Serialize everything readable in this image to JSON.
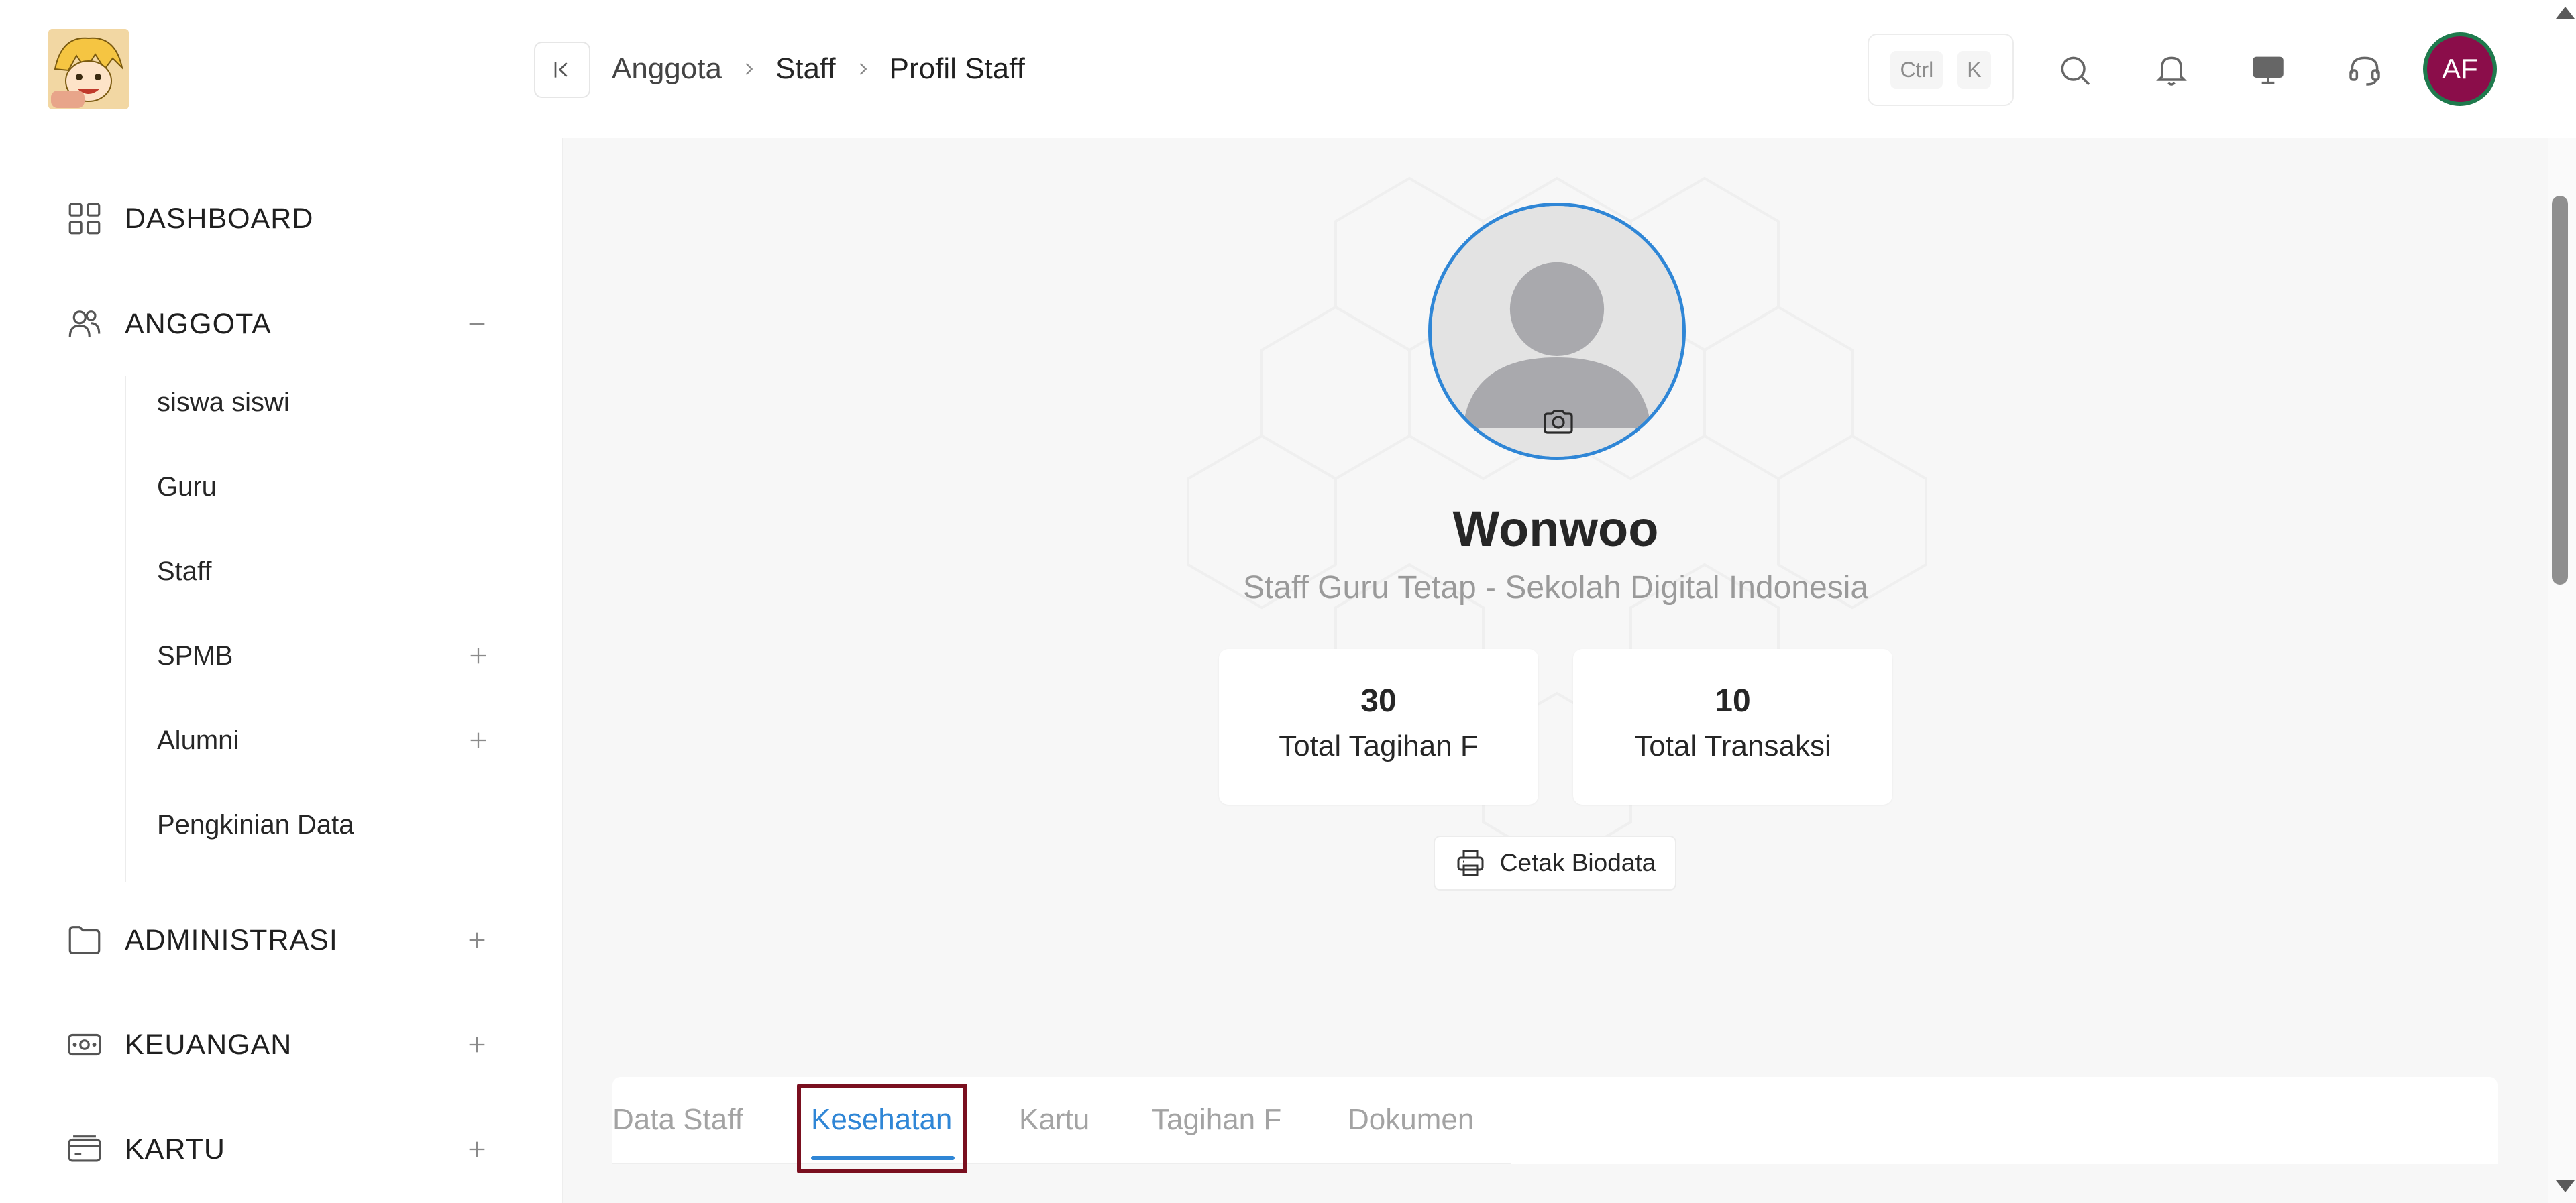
{
  "sidebar": {
    "logo_icon": "anime-logo-icon",
    "items": [
      {
        "label": "DASHBOARD",
        "icon": "dashboard-icon",
        "toggle": ""
      },
      {
        "label": "ANGGOTA",
        "icon": "users-icon",
        "toggle": "minus"
      },
      {
        "label": "ADMINISTRASI",
        "icon": "folder-icon",
        "toggle": "plus"
      },
      {
        "label": "KEUANGAN",
        "icon": "money-icon",
        "toggle": "plus"
      },
      {
        "label": "KARTU",
        "icon": "card-icon",
        "toggle": "plus"
      }
    ],
    "anggota_sub": [
      {
        "label": "siswa siswi",
        "toggle": ""
      },
      {
        "label": "Guru",
        "toggle": ""
      },
      {
        "label": "Staff",
        "toggle": ""
      },
      {
        "label": "SPMB",
        "toggle": "plus"
      },
      {
        "label": "Alumni",
        "toggle": "plus"
      },
      {
        "label": "Pengkinian Data",
        "toggle": ""
      }
    ]
  },
  "header": {
    "breadcrumb": [
      "Anggota",
      "Staff",
      "Profil Staff"
    ],
    "shortcut": {
      "key1": "Ctrl",
      "key2": "K"
    },
    "icons": [
      "search-icon",
      "bell-icon",
      "monitor-icon",
      "headset-icon"
    ],
    "avatar_initials": "AF"
  },
  "profile": {
    "name": "Wonwoo",
    "subtitle": "Staff Guru Tetap - Sekolah Digital Indonesia",
    "stats": [
      {
        "value": "30",
        "label": "Total Tagihan F"
      },
      {
        "value": "10",
        "label": "Total Transaksi"
      }
    ],
    "print_label": "Cetak Biodata"
  },
  "tabs": {
    "items": [
      "Data Staff",
      "Kesehatan",
      "Kartu",
      "Tagihan F",
      "Dokumen"
    ],
    "active": "Kesehatan"
  },
  "colors": {
    "accent": "#2f86d6",
    "avatar_bg": "#8b0d4a",
    "highlight": "#7a0f1f"
  }
}
